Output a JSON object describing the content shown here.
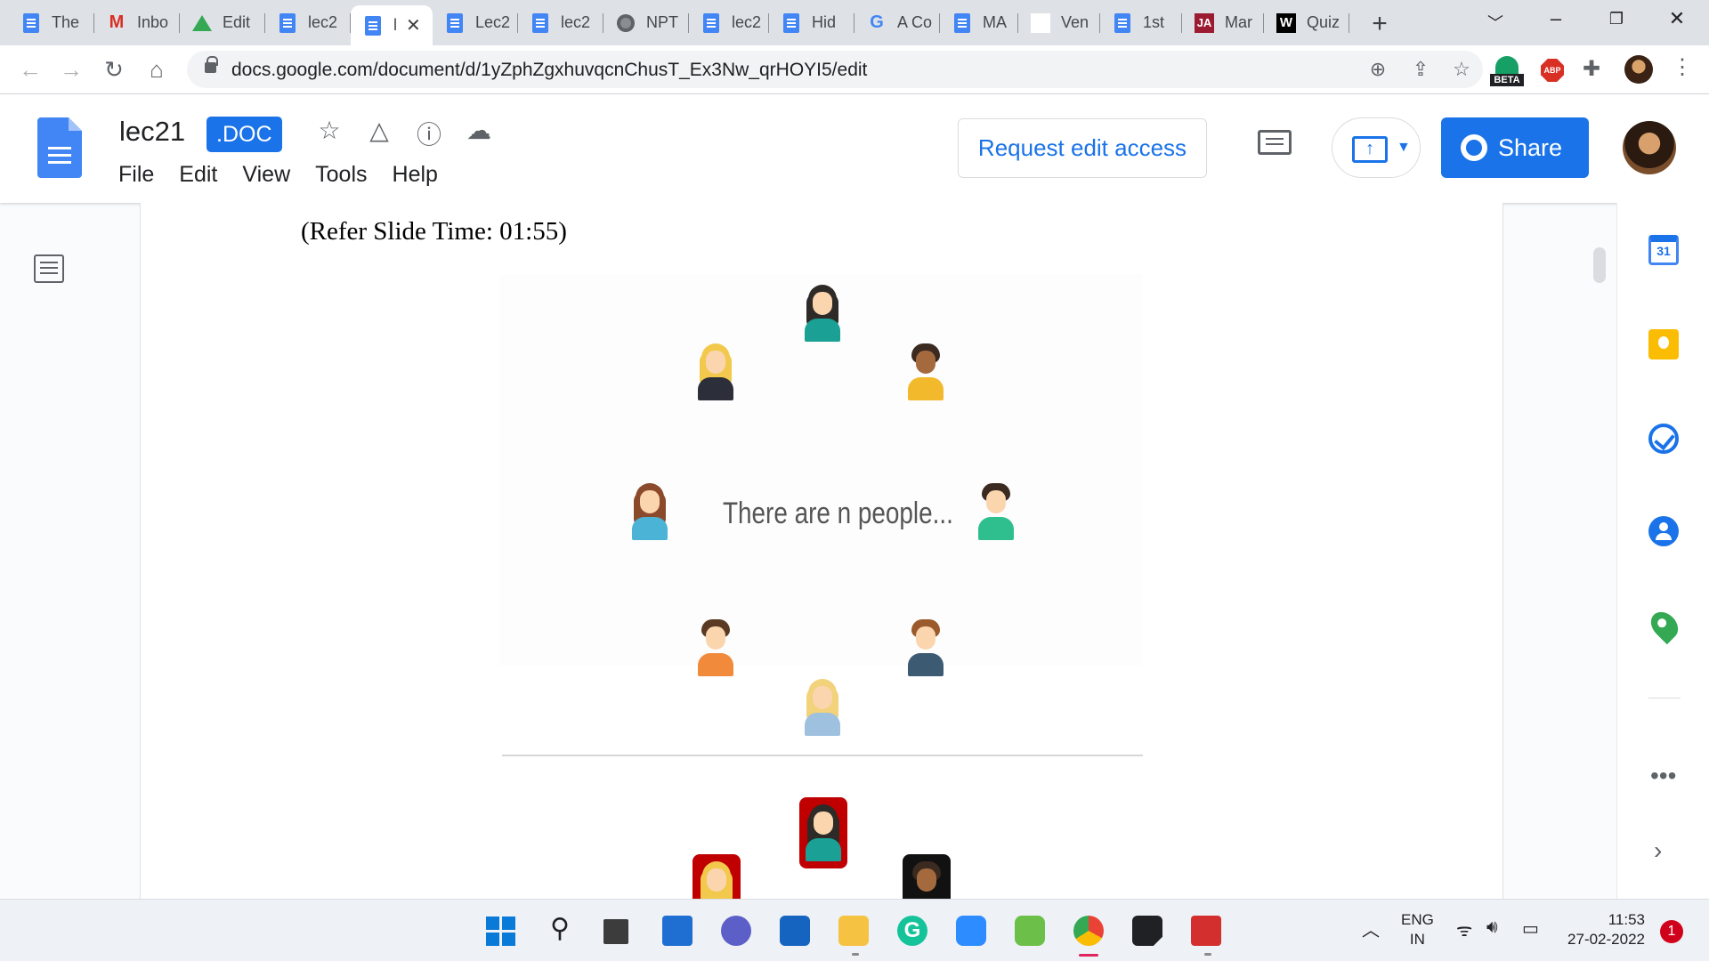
{
  "browser": {
    "tabs": [
      {
        "title": "The",
        "icon": "docs-icon"
      },
      {
        "title": "Inbo",
        "icon": "gmail-icon"
      },
      {
        "title": "Edit",
        "icon": "drive-icon"
      },
      {
        "title": "lec2",
        "icon": "docs-icon"
      },
      {
        "title": "l",
        "icon": "docs-icon",
        "active": true
      },
      {
        "title": "Lec2",
        "icon": "docs-icon"
      },
      {
        "title": "lec2",
        "icon": "docs-icon"
      },
      {
        "title": "NPT",
        "icon": "globe-icon"
      },
      {
        "title": "lec2",
        "icon": "docs-icon"
      },
      {
        "title": "Hid",
        "icon": "docs-icon"
      },
      {
        "title": "A Co",
        "icon": "google-icon"
      },
      {
        "title": "MA",
        "icon": "docs-icon"
      },
      {
        "title": "Ven",
        "icon": "blank-icon"
      },
      {
        "title": "1st",
        "icon": "docs-icon"
      },
      {
        "title": "Mar",
        "icon": "ja-icon"
      },
      {
        "title": "Quiz",
        "icon": "w-icon"
      }
    ],
    "new_tab": "+",
    "url": "docs.google.com/document/d/1yZphZgxhuvqcnChusT_Ex3Nw_qrHOYI5/edit",
    "beta_label": "BETA",
    "abp_label": "ABP"
  },
  "docs": {
    "title": "lec21",
    "badge": ".DOC",
    "menu": [
      "File",
      "Edit",
      "View",
      "Tools",
      "Help"
    ],
    "request_access": "Request edit access",
    "share": "Share"
  },
  "document": {
    "refer_line": "(Refer Slide Time: 01:55)",
    "slide_text": "There are n people..."
  },
  "side_panel": {
    "calendar_day": "31",
    "more": "•••",
    "collapse": "›"
  },
  "taskbar": {
    "lang_top": "ENG",
    "lang_bottom": "IN",
    "time": "11:53",
    "date": "27-02-2022",
    "notifications": "1"
  }
}
